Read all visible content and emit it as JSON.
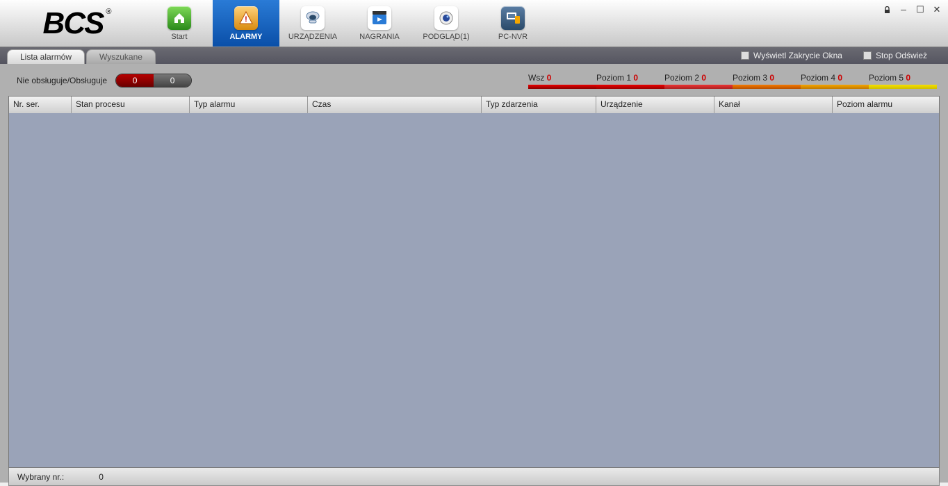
{
  "logo": {
    "text": "BCS",
    "reg": "®"
  },
  "nav": {
    "start": "Start",
    "alarmy": "ALARMY",
    "urzadzenia": "URZĄDZENIA",
    "nagrania": "NAGRANIA",
    "podglad": "PODGLĄD(1)",
    "pcnvr": "PC-NVR"
  },
  "subtabs": {
    "lista": "Lista alarmów",
    "wyszukane": "Wyszukane"
  },
  "options": {
    "cover": "Wyświetl Zakrycie Okna",
    "stop": "Stop Odśwież"
  },
  "handle": {
    "label": "Nie obsługuje/Obsługuje",
    "left": "0",
    "right": "0"
  },
  "levels": {
    "wsz_label": "Wsz",
    "wsz_val": "0",
    "p1_label": "Poziom 1",
    "p1_val": "0",
    "p2_label": "Poziom 2",
    "p2_val": "0",
    "p3_label": "Poziom 3",
    "p3_val": "0",
    "p4_label": "Poziom 4",
    "p4_val": "0",
    "p5_label": "Poziom 5",
    "p5_val": "0"
  },
  "columns": {
    "nr": "Nr. ser.",
    "stan": "Stan procesu",
    "typ_alarmu": "Typ alarmu",
    "czas": "Czas",
    "typ_zdarzenia": "Typ zdarzenia",
    "urzadzenie": "Urządzenie",
    "kanal": "Kanał",
    "poziom": "Poziom alarmu"
  },
  "footer": {
    "label": "Wybrany nr.:",
    "value": "0"
  }
}
